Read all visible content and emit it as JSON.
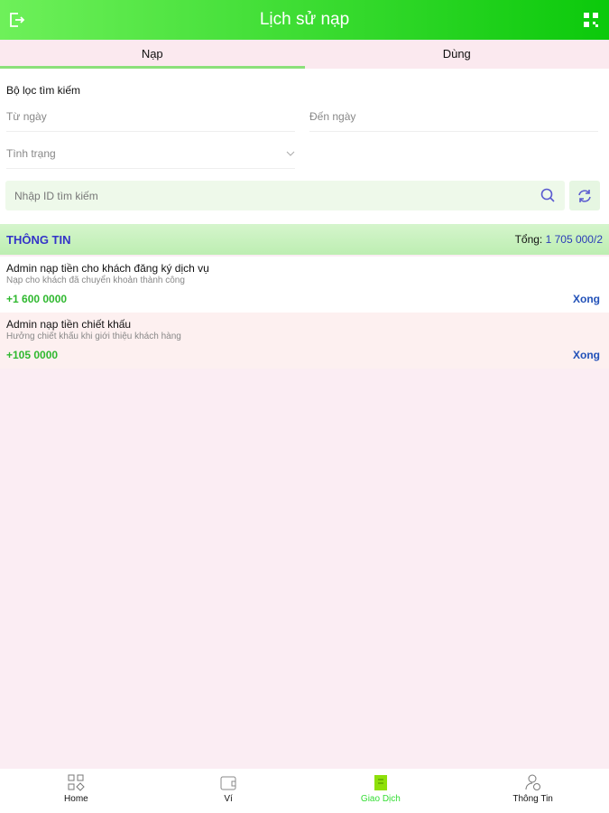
{
  "header": {
    "title": "Lịch sử nạp",
    "left_icon": "logout-icon",
    "right_icon": "qr-code-icon"
  },
  "tabs": [
    {
      "label": "Nạp",
      "active": true
    },
    {
      "label": "Dùng",
      "active": false
    }
  ],
  "filter": {
    "label": "Bộ lọc tìm kiếm",
    "from_placeholder": "Từ ngày",
    "to_placeholder": "Đến ngày",
    "status_placeholder": "Tình trạng",
    "search_placeholder": "Nhập ID tìm kiếm"
  },
  "section": {
    "title": "THÔNG TIN",
    "total_label": "Tổng:",
    "total_value": "1 705 000/2"
  },
  "items": [
    {
      "title": "Admin nạp tiền cho khách đăng ký dịch vụ",
      "subtitle": "Nạp cho khách đã chuyển khoản thành công",
      "amount": "+1 600 0000",
      "status": "Xong"
    },
    {
      "title": "Admin nạp tiền chiết khấu",
      "subtitle": "Hưởng chiết khấu khi giới thiệu khách hàng",
      "amount": "+105 0000",
      "status": "Xong"
    }
  ],
  "nav": [
    {
      "label": "Home"
    },
    {
      "label": "Ví"
    },
    {
      "label": "Giao Dịch",
      "active": true
    },
    {
      "label": "Thông Tin"
    }
  ],
  "colors": {
    "accent": "#22cc22",
    "active_nav": "#33dd33"
  }
}
